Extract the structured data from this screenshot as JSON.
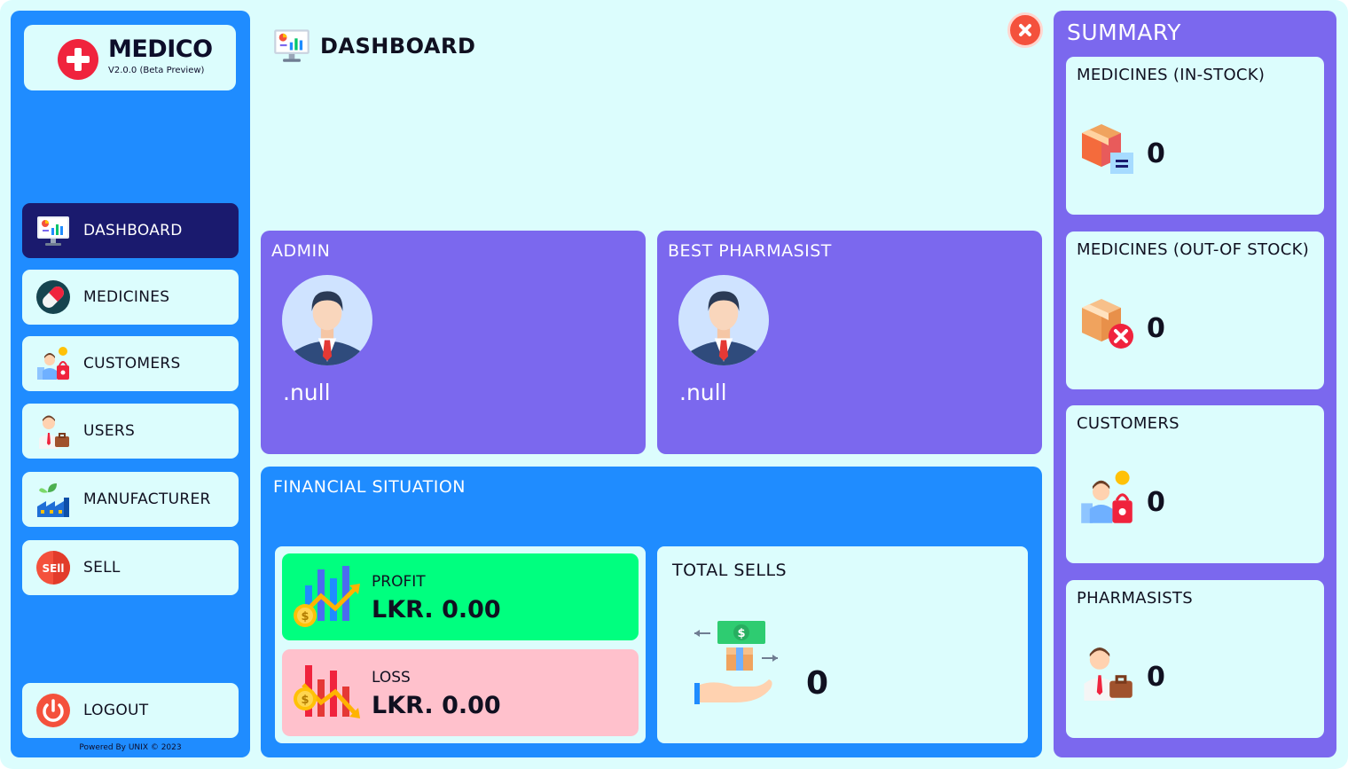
{
  "app": {
    "name": "MEDICO",
    "version": "V2.0.0 (Beta Preview)",
    "powered_by": "Powered By UNIX © 2023"
  },
  "sidebar": {
    "items": [
      {
        "label": "DASHBOARD",
        "icon": "dashboard-monitor-icon",
        "active": true
      },
      {
        "label": "MEDICINES",
        "icon": "pill-capsule-icon",
        "active": false
      },
      {
        "label": "CUSTOMERS",
        "icon": "customers-icon",
        "active": false
      },
      {
        "label": "USERS",
        "icon": "user-briefcase-icon",
        "active": false
      },
      {
        "label": "MANUFACTURER",
        "icon": "factory-icon",
        "active": false
      },
      {
        "label": "SELL",
        "icon": "sell-badge-icon",
        "active": false
      }
    ],
    "logout_label": "LOGOUT"
  },
  "header": {
    "title": "DASHBOARD"
  },
  "admin_card": {
    "title": "ADMIN",
    "name": ".null"
  },
  "pharmasist_card": {
    "title": "BEST PHARMASIST",
    "name": ".null"
  },
  "financial": {
    "title": "FINANCIAL SITUATION",
    "profit_label": "PROFIT",
    "profit_value": "LKR. 0.00",
    "loss_label": "LOSS",
    "loss_value": "LKR. 0.00",
    "total_sells_label": "TOTAL SELLS",
    "total_sells_value": "0"
  },
  "summary": {
    "title": "SUMMARY",
    "cards": [
      {
        "label": "MEDICINES (IN-STOCK)",
        "value": "0"
      },
      {
        "label": "MEDICINES (OUT-OF STOCK)",
        "value": "0"
      },
      {
        "label": "CUSTOMERS",
        "value": "0"
      },
      {
        "label": "PHARMASISTS",
        "value": "0"
      }
    ]
  },
  "colors": {
    "sidebar_bg": "#1f8cff",
    "panel_bg": "#dcfdfd",
    "purple": "#7b68ee",
    "active_nav": "#1a1a6e",
    "profit": "#00ff7f",
    "loss": "#ffc1cc",
    "close": "#f4513c"
  }
}
